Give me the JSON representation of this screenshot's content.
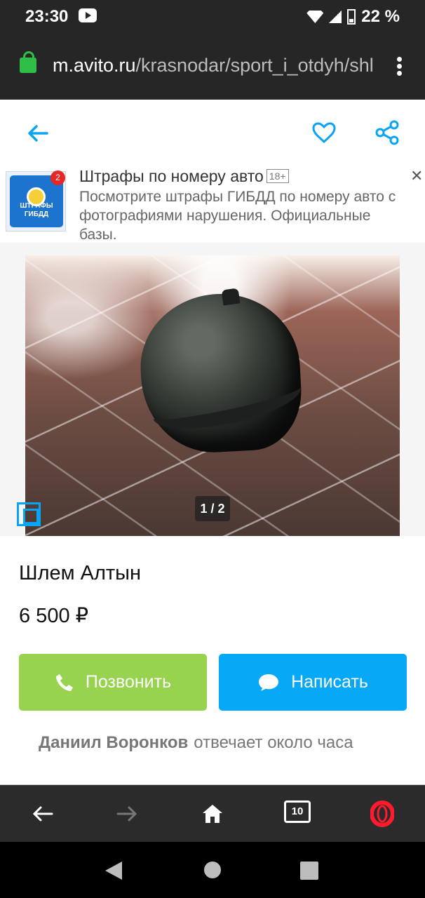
{
  "status": {
    "time": "23:30",
    "battery": "22 %"
  },
  "browser": {
    "url_host": "m.avito.ru",
    "url_path": "/krasnodar/sport_i_otdyh/shl"
  },
  "ad": {
    "title": "Штрафы по номеру авто",
    "age": "18+",
    "description": "Посмотрите штрафы ГИБДД по номеру авто с фотографиями нарушения. Официальные базы.",
    "logo_text": "ШТРАФЫ ГИБДД",
    "badge": "2"
  },
  "listing": {
    "photo_counter": "1 / 2",
    "title": "Шлем Алтын",
    "price": "6 500 ₽"
  },
  "actions": {
    "call": "Позвонить",
    "message": "Написать"
  },
  "seller": {
    "name": "Даниил Воронков",
    "response": "отвечает около часа"
  },
  "browser_nav": {
    "tabs_count": "10"
  },
  "colors": {
    "accent": "#0aa4f5",
    "call_button": "#97d34f",
    "message_button": "#07a8f5",
    "browser_bar": "#262626",
    "opera_red": "#ff1b2d"
  },
  "icons": [
    "back-arrow-icon",
    "heart-icon",
    "share-icon",
    "phone-icon",
    "chat-icon",
    "home-icon",
    "tabs-icon",
    "opera-icon"
  ]
}
